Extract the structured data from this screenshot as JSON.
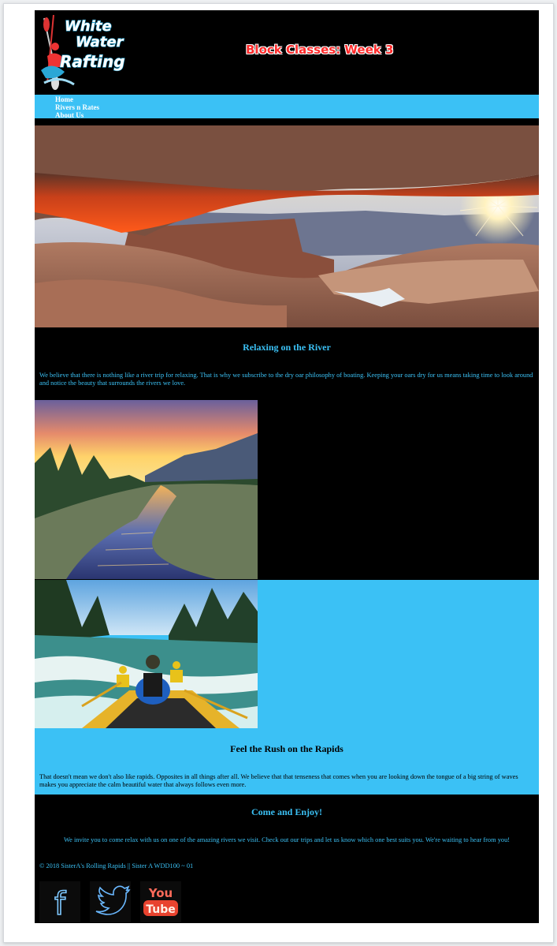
{
  "header": {
    "logo_alt": "White Water Rafting",
    "logo_words": [
      "White",
      "Water",
      "Rafting"
    ],
    "title": "Block Classes:  Week 3"
  },
  "nav": {
    "items": [
      "Home",
      "Rivers n Rates",
      "About Us"
    ]
  },
  "sections": {
    "relaxing": {
      "title": "Relaxing on the River",
      "text": "We believe that there is nothing like a river trip for relaxing. That is why we subscribe to the dry oar philosophy of boating. Keeping your oars dry for us means taking time to look around and notice the beauty that surrounds the rivers we love."
    },
    "rapids": {
      "title": "Feel the Rush on the Rapids",
      "text": "That doesn't mean we don't also like rapids. Opposites in all things after all. We believe that that tenseness that comes when you are looking down the tongue of a big string of waves makes you appreciate the calm beautiful water that always follows even more."
    },
    "enjoy": {
      "title": "Come and Enjoy!",
      "text": "We invite you to come relax with us on one of the amazing rivers we visit. Check out our trips and let us know which one best suits you. We're waiting to hear from you!"
    }
  },
  "footer": {
    "copyright": "© 2018 SisterA's Rolling Rapids || Sister A WDD100 ~ 01"
  },
  "social": {
    "items": [
      {
        "name": "facebook-icon",
        "glyph": "f"
      },
      {
        "name": "twitter-icon"
      },
      {
        "name": "youtube-icon",
        "top": "You",
        "bottom": "Tube"
      }
    ]
  },
  "colors": {
    "accent": "#3bc1f5",
    "page_bg": "#000000",
    "title_red": "#ff2a2a"
  }
}
